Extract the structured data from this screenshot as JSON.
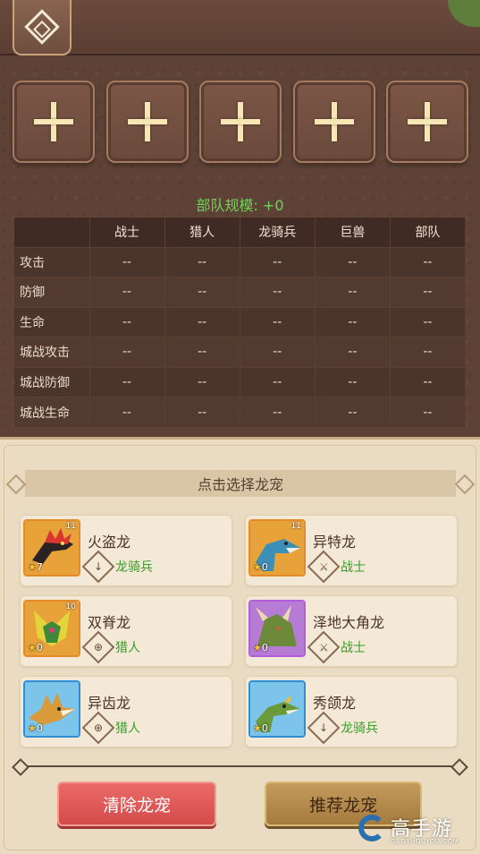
{
  "troop_scale": "部队规模: +0",
  "slots": [
    "+",
    "+",
    "+",
    "+",
    "+"
  ],
  "stats": {
    "headers": [
      "",
      "战士",
      "猎人",
      "龙骑兵",
      "巨兽",
      "部队"
    ],
    "rows": [
      {
        "label": "攻击",
        "values": [
          "--",
          "--",
          "--",
          "--",
          "--"
        ]
      },
      {
        "label": "防御",
        "values": [
          "--",
          "--",
          "--",
          "--",
          "--"
        ]
      },
      {
        "label": "生命",
        "values": [
          "--",
          "--",
          "--",
          "--",
          "--"
        ]
      },
      {
        "label": "城战攻击",
        "values": [
          "--",
          "--",
          "--",
          "--",
          "--"
        ]
      },
      {
        "label": "城战防御",
        "values": [
          "--",
          "--",
          "--",
          "--",
          "--"
        ]
      },
      {
        "label": "城战生命",
        "values": [
          "--",
          "--",
          "--",
          "--",
          "--"
        ]
      }
    ]
  },
  "select_header": "点击选择龙宠",
  "pets": [
    {
      "name": "火盗龙",
      "type": "龙骑兵",
      "type_icon": "dragoon-icon",
      "stars": "7",
      "level": "11",
      "frame": "orange"
    },
    {
      "name": "异特龙",
      "type": "战士",
      "type_icon": "warrior-icon",
      "stars": "0",
      "level": "11",
      "frame": "orange"
    },
    {
      "name": "双脊龙",
      "type": "猎人",
      "type_icon": "hunter-icon",
      "stars": "0",
      "level": "10",
      "frame": "orange"
    },
    {
      "name": "泽地大角龙",
      "type": "战士",
      "type_icon": "warrior-icon",
      "stars": "0",
      "level": "",
      "frame": "purple"
    },
    {
      "name": "异齿龙",
      "type": "猎人",
      "type_icon": "hunter-icon",
      "stars": "0",
      "level": "",
      "frame": "blue"
    },
    {
      "name": "秀颌龙",
      "type": "龙骑兵",
      "type_icon": "dragoon-icon",
      "stars": "0",
      "level": "",
      "frame": "blue"
    }
  ],
  "buttons": {
    "clear": "清除龙宠",
    "recommend": "推荐龙宠"
  },
  "watermark": {
    "title": "高手游",
    "sub": "GAOSHOUYOU.COM"
  }
}
